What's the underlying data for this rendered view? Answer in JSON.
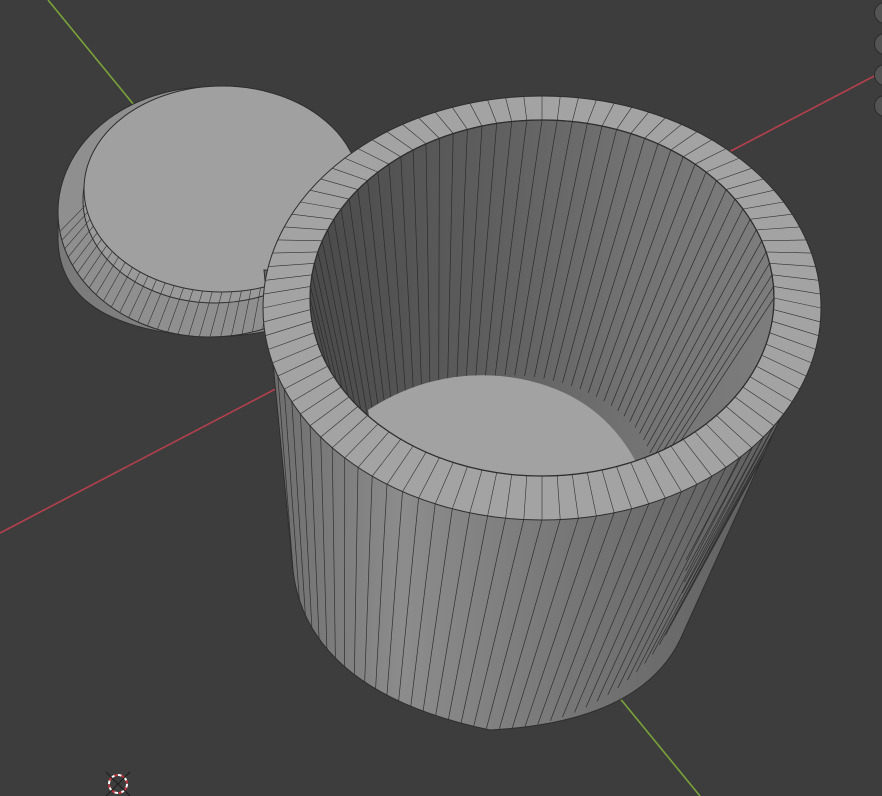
{
  "app": "3D Viewport",
  "scene": {
    "objects": [
      {
        "name": "cup-body",
        "type": "mesh"
      },
      {
        "name": "lid",
        "type": "mesh"
      }
    ],
    "axes": {
      "x": {
        "color": "#b5404d"
      },
      "y": {
        "color": "#7aa33a"
      }
    },
    "mesh_color": "#9b9b9b",
    "background_color": "#3d3d3d"
  },
  "gizmo_buttons": [
    {
      "icon": "zoom-icon"
    },
    {
      "icon": "pan-icon"
    },
    {
      "icon": "camera-icon"
    },
    {
      "icon": "perspective-icon"
    }
  ],
  "cursor_3d": {
    "icon": "3d-cursor-icon"
  }
}
